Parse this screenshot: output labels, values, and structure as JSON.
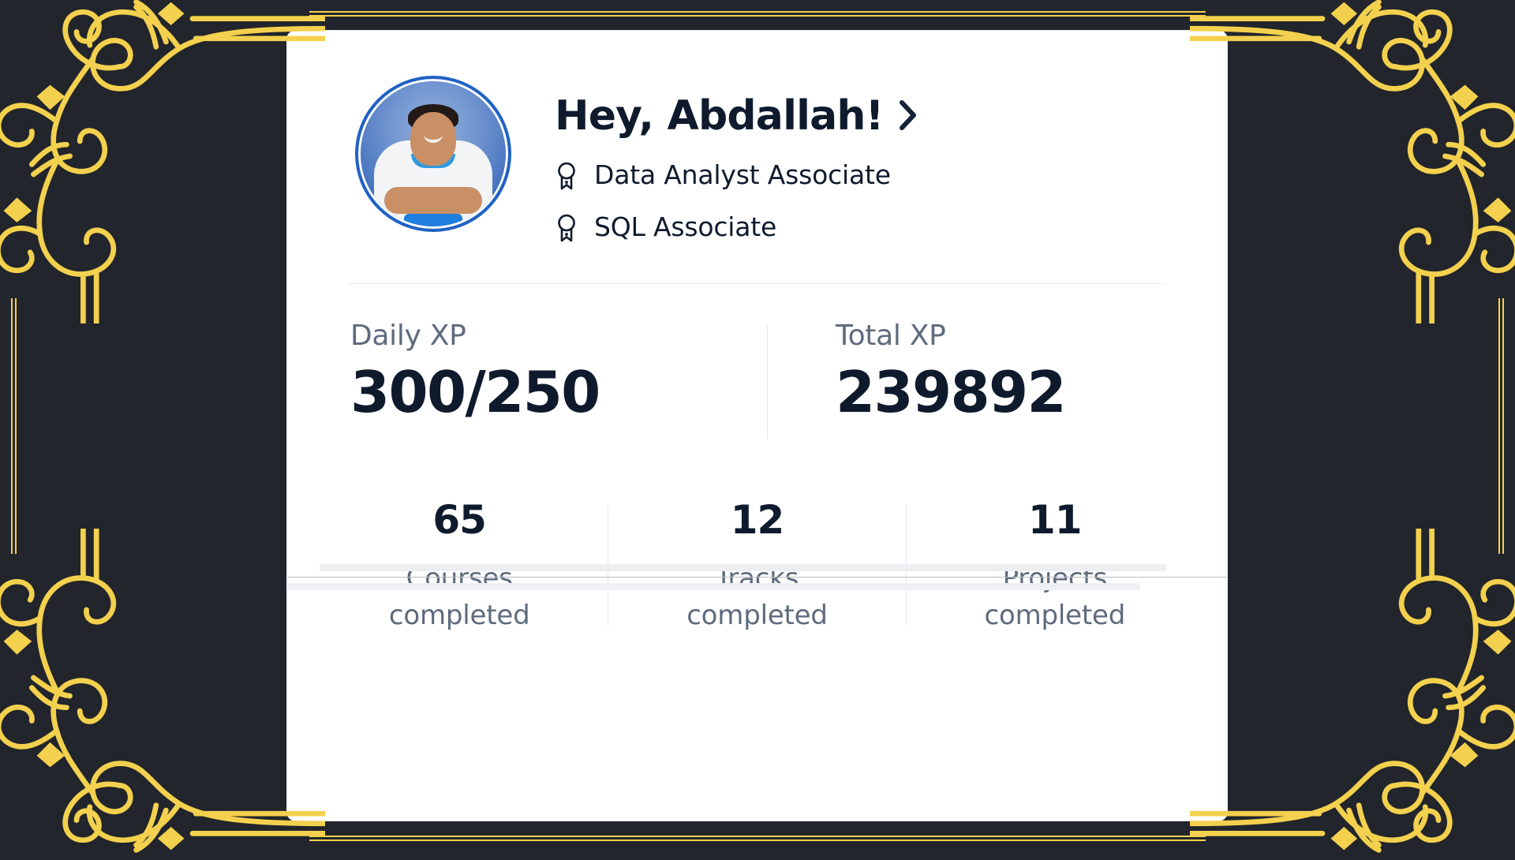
{
  "theme": {
    "page_background": "#22252b",
    "ornament_gold": "#f3d14e",
    "card_background": "#ffffff",
    "text_dark": "#0f1b2d",
    "text_muted": "#5d6b7d",
    "divider": "#e4e7ec",
    "avatar_ring": "#1f62c4"
  },
  "frame": {
    "ornament_name": "gold-corner-flourish",
    "corners": [
      "top-left",
      "top-right",
      "bottom-left",
      "bottom-right"
    ]
  },
  "card": {
    "header": {
      "avatar_alt": "user-avatar",
      "greeting": "Hey, Abdallah!",
      "chevron_icon": "chevron-right-icon",
      "certifications": [
        {
          "icon": "award-badge-icon",
          "label": "Data Analyst Associate"
        },
        {
          "icon": "award-badge-icon",
          "label": "SQL Associate"
        }
      ]
    },
    "xp": [
      {
        "label": "Daily XP",
        "value": "300/250"
      },
      {
        "label": "Total XP",
        "value": "239892"
      }
    ],
    "stats": [
      {
        "value": "65",
        "label_line1": "Courses",
        "label_line2": "completed"
      },
      {
        "value": "12",
        "label_line1": "Tracks",
        "label_line2": "completed"
      },
      {
        "value": "11",
        "label_line1": "Projects",
        "label_line2": "completed"
      }
    ]
  }
}
